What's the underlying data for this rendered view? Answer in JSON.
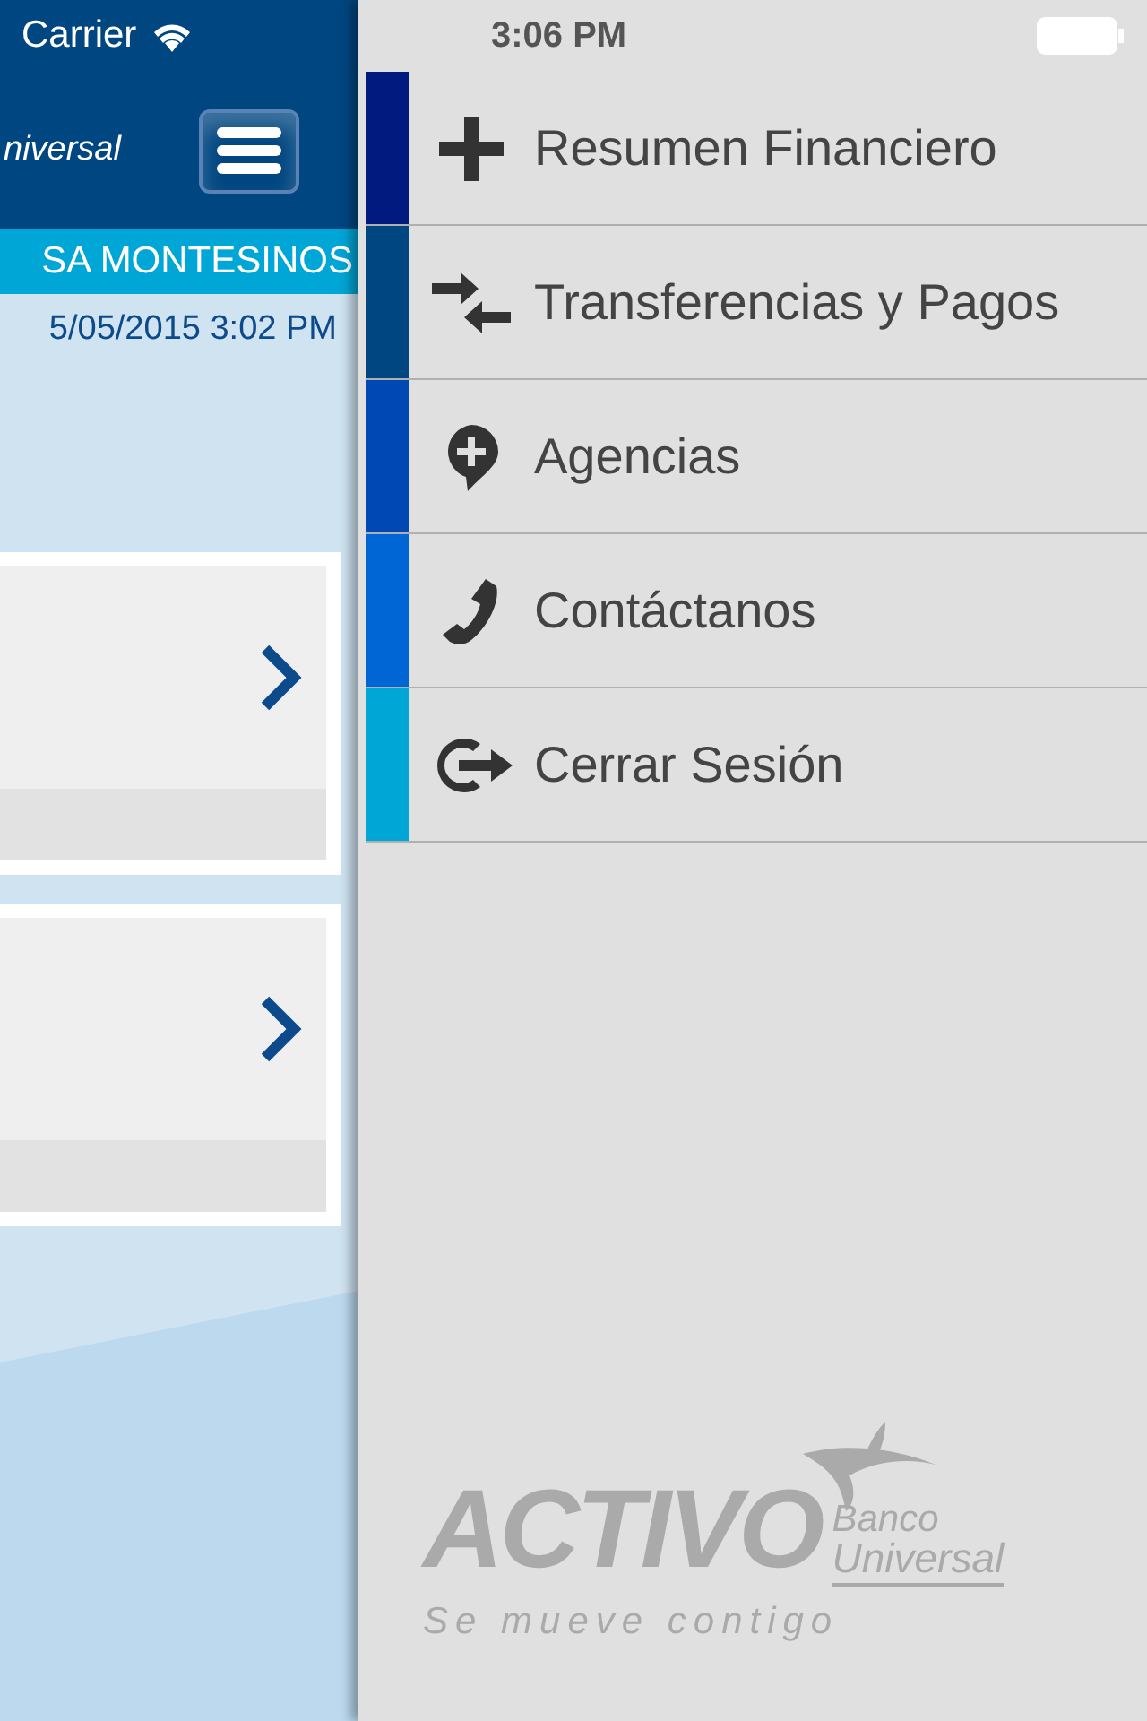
{
  "status_bar": {
    "carrier": "Carrier",
    "time": "3:06 PM"
  },
  "header": {
    "logo_text": "niversal"
  },
  "user": {
    "name": "SA MONTESINOS",
    "last_access": "5/05/2015 3:02 PM"
  },
  "cards": [
    {
      "kind": "card"
    },
    {
      "kind": "card"
    }
  ],
  "menu": {
    "items": [
      {
        "label": "Resumen Financiero",
        "kind": "plus",
        "color": "#001a80"
      },
      {
        "label": "Transferencias y Pagos",
        "kind": "transfer",
        "color": "#004680"
      },
      {
        "label": "Agencias",
        "kind": "pin",
        "color": "#0048b4"
      },
      {
        "label": "Contáctanos",
        "kind": "phone",
        "color": "#0066d6"
      },
      {
        "label": "Cerrar Sesión",
        "kind": "logout",
        "color": "#00a6d6"
      }
    ]
  },
  "brand": {
    "name": "ACTIVO",
    "line1": "Banco",
    "line2": "Universal",
    "slogan": "Se mueve contigo"
  }
}
